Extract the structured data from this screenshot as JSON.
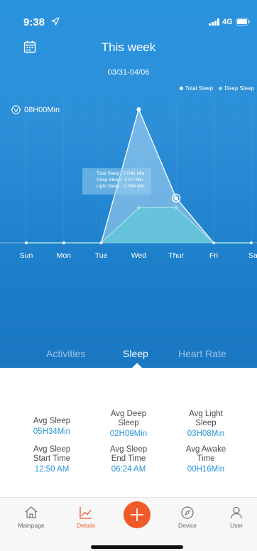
{
  "status_bar": {
    "time": "9:38",
    "network": "4G"
  },
  "header": {
    "title": "This week",
    "date_range": "03/31-04/06",
    "calendar_icon": "calendar-icon"
  },
  "chart_legend": {
    "total_sleep": "Total Sleep",
    "deep_sleep": "Deep Sleep"
  },
  "goal": {
    "label": "08H00Min",
    "icon": "sleep-goal-icon"
  },
  "tooltip": {
    "total_sleep": "Total Sleep : 2 H41 Min",
    "deep_sleep": "Deep Sleep : 2 H7 Min",
    "light_sleep": "Light Sleep : 0 H34 Min"
  },
  "colors": {
    "accent": "#2a93de",
    "active_nav": "#f05a28",
    "background": "#2a93de"
  },
  "chart_data": {
    "type": "area",
    "categories": [
      "Sun",
      "Mon",
      "Tue",
      "Wed",
      "Thur",
      "Fri",
      "Sat"
    ],
    "series": [
      {
        "name": "Total Sleep",
        "values": [
          0,
          0,
          0,
          8.0,
          2.68,
          0,
          0
        ]
      },
      {
        "name": "Deep Sleep",
        "values": [
          0,
          0,
          0,
          2.1,
          2.12,
          0,
          0
        ]
      }
    ],
    "ylim": [
      0,
      8
    ],
    "grid": false,
    "legend": "top-right"
  },
  "tabs": [
    {
      "label": "Activities",
      "active": false
    },
    {
      "label": "Sleep",
      "active": true
    },
    {
      "label": "Heart Rate",
      "active": false
    }
  ],
  "stats": [
    {
      "label": "Avg Sleep",
      "value": "05H34Min"
    },
    {
      "label": "Avg Deep Sleep",
      "value": "02H09Min"
    },
    {
      "label": "Avg Light Sleep",
      "value": "03H08Min"
    },
    {
      "label": "Avg Sleep Start Time",
      "value": "12:50 AM"
    },
    {
      "label": "Avg Sleep End Time",
      "value": "06:24 AM"
    },
    {
      "label": "Avg Awake Time",
      "value": "00H16Min"
    }
  ],
  "nav": [
    {
      "label": "Mainpage",
      "icon": "home-icon",
      "active": false
    },
    {
      "label": "Details",
      "icon": "chart-icon",
      "active": true
    },
    {
      "label": "Device",
      "icon": "compass-icon",
      "active": false
    },
    {
      "label": "User",
      "icon": "user-icon",
      "active": false
    }
  ]
}
